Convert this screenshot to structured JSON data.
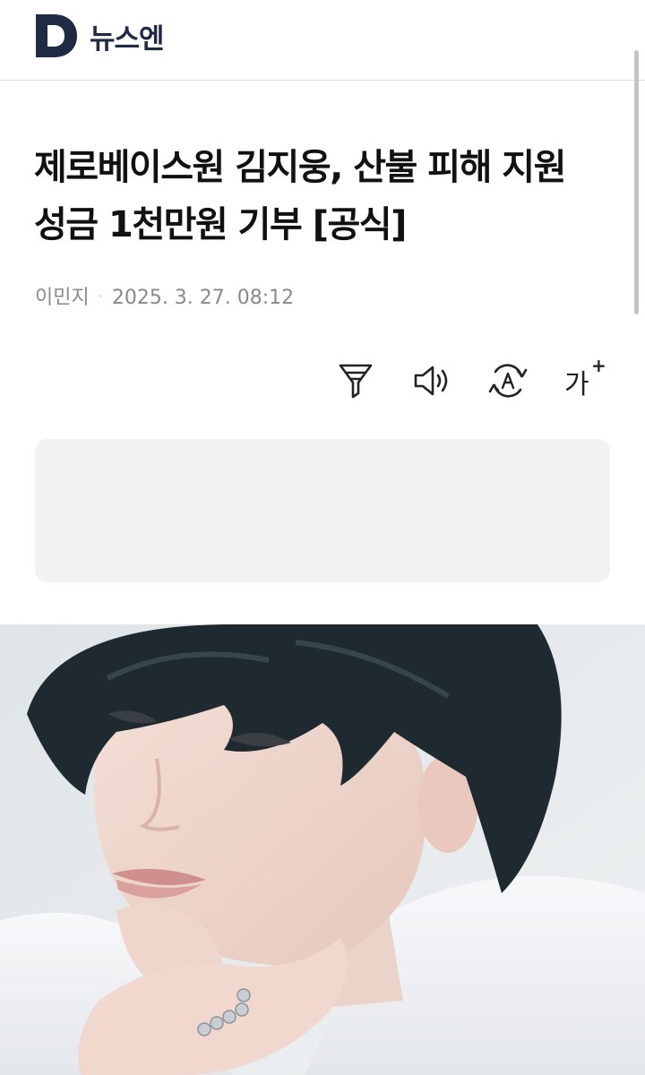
{
  "header": {
    "logo_letter": "D",
    "site_name": "뉴스엔"
  },
  "article": {
    "headline": "제로베이스원 김지웅, 산불 피해 지원 성금 1천만원 기부 [공식]",
    "author": "이민지",
    "separator": "·",
    "datetime": "2025. 3. 27. 08:12"
  },
  "toolbar": {
    "summary_icon": "filter-funnel-icon",
    "audio_icon": "speaker-icon",
    "translate_icon": "translate-icon",
    "font_size_label": "가",
    "font_size_plus": "+"
  },
  "colors": {
    "brand_navy": "#1f2a44",
    "ad_background": "#f2f2f2",
    "meta_text": "#8a8a8a"
  }
}
